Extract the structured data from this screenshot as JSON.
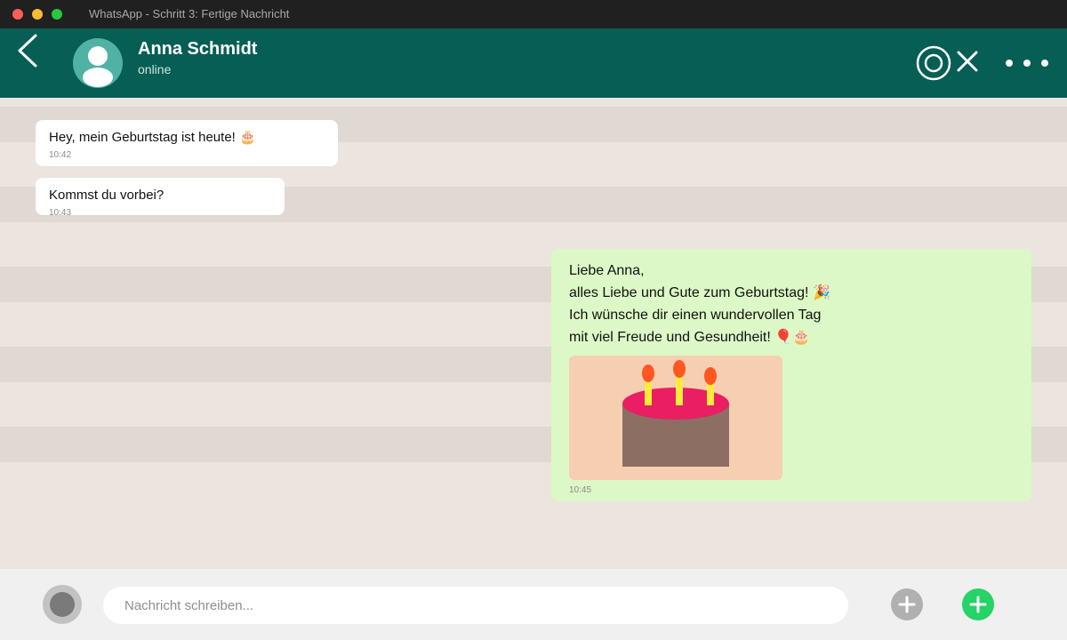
{
  "window": {
    "title": "WhatsApp - Schritt 3: Fertige Nachricht"
  },
  "header": {
    "contact_name": "Anna Schmidt",
    "status": "online"
  },
  "messages": [
    {
      "direction": "in",
      "text": "Hey, mein Geburtstag ist heute! 🎂",
      "time": "10:42"
    },
    {
      "direction": "in",
      "text": "Kommst du vorbei?",
      "time": "10:43"
    },
    {
      "direction": "out",
      "lines": [
        "Liebe Anna,",
        "alles Liebe und Gute zum Geburtstag! 🎉",
        "Ich wünsche dir einen wundervollen Tag",
        "mit viel Freude und Gesundheit! 🎈🎂"
      ],
      "image": "birthday-cake",
      "time": "10:45"
    }
  ],
  "composer": {
    "placeholder": "Nachricht schreiben..."
  },
  "colors": {
    "header": "#075e54",
    "outgoing_bubble": "#dcf8c6",
    "incoming_bubble": "#ffffff",
    "send_button": "#25d366"
  }
}
